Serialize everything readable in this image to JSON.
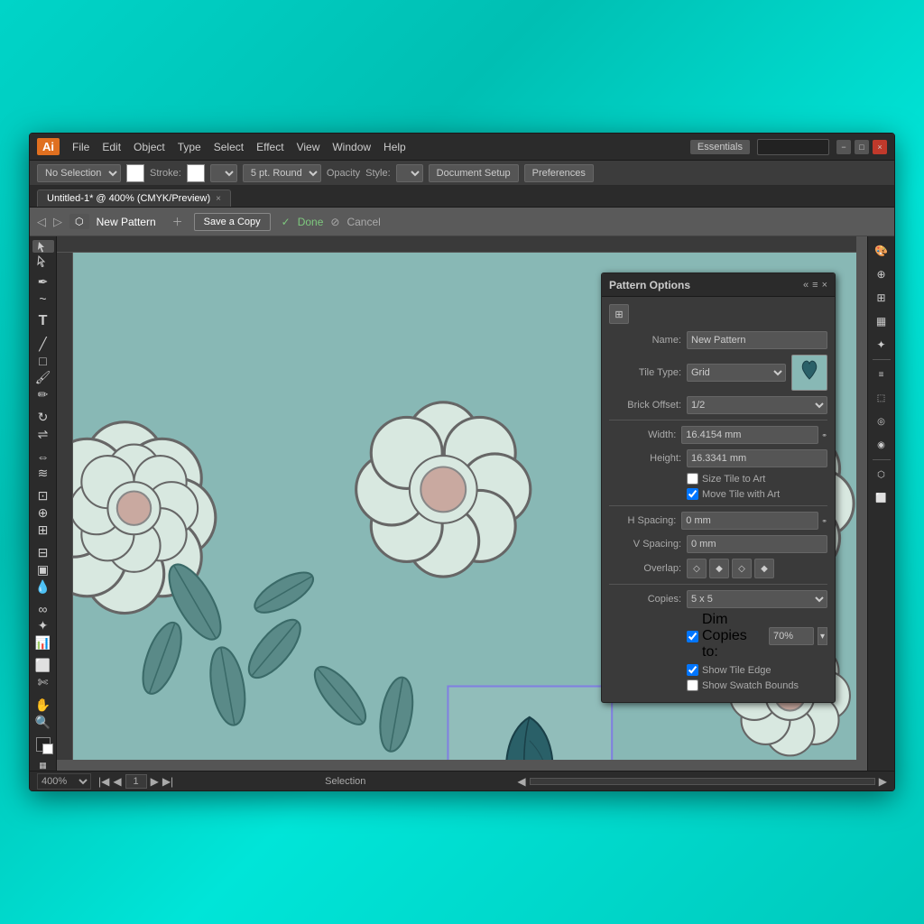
{
  "app": {
    "logo": "Ai",
    "title": "Untitled-1* @ 400% (CMYK/Preview)",
    "tab_close": "×"
  },
  "menu": {
    "items": [
      "File",
      "Edit",
      "Object",
      "Type",
      "Select",
      "Effect",
      "View",
      "Window",
      "Help"
    ]
  },
  "titlebar": {
    "essentials": "Essentials",
    "win_minimize": "−",
    "win_restore": "□",
    "win_close": "×"
  },
  "options_bar": {
    "no_selection": "No Selection",
    "stroke_label": "Stroke:",
    "round_option": "5 pt. Round",
    "opacity_label": "Opacity",
    "style_label": "Style:",
    "doc_setup": "Document Setup",
    "preferences": "Preferences"
  },
  "pattern_toolbar": {
    "new_pattern_icon": "◈",
    "pattern_label": "New Pattern",
    "save_copy": "Save a Copy",
    "done": "Done",
    "cancel": "Cancel"
  },
  "status_bar": {
    "zoom": "400%",
    "page_num": "1",
    "selection_label": "Selection"
  },
  "panel": {
    "title": "Pattern Options",
    "name_label": "Name:",
    "name_value": "New Pattern",
    "tile_type_label": "Tile Type:",
    "tile_type_value": "Grid",
    "brick_offset_label": "Brick Offset:",
    "brick_offset_value": "1/2",
    "width_label": "Width:",
    "width_value": "16.4154 mm",
    "height_label": "Height:",
    "height_value": "16.3341 mm",
    "size_tile_label": "Size Tile to Art",
    "move_tile_label": "Move Tile with Art",
    "h_spacing_label": "H Spacing:",
    "h_spacing_value": "0 mm",
    "v_spacing_label": "V Spacing:",
    "v_spacing_value": "0 mm",
    "overlap_label": "Overlap:",
    "copies_label": "Copies:",
    "copies_value": "5 x 5",
    "dim_copies_label": "Dim Copies to:",
    "dim_copies_value": "70%",
    "show_tile_edge": "Show Tile Edge",
    "show_swatch_bounds": "Show Swatch Bounds",
    "size_tile_checked": false,
    "move_tile_checked": true,
    "dim_copies_checked": true,
    "show_tile_edge_checked": true,
    "show_swatch_bounds_checked": false
  },
  "canvas": {
    "bg_color": "#88b8b5"
  }
}
